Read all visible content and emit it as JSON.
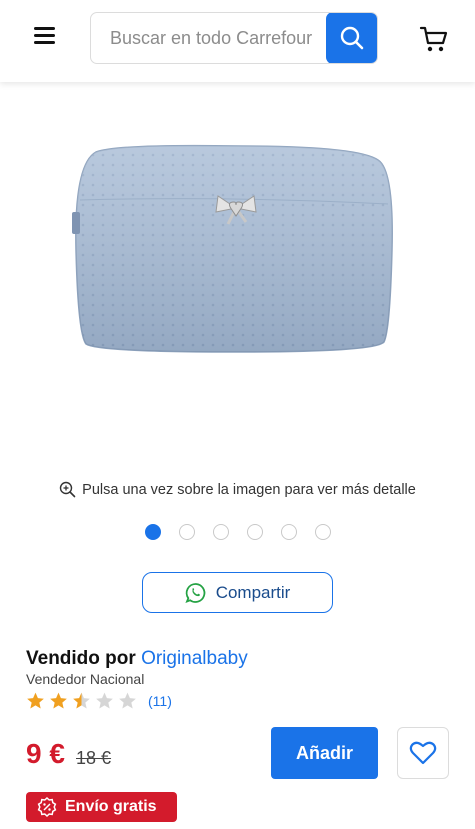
{
  "header": {
    "menu_icon": "hamburger-menu-icon",
    "search": {
      "placeholder": "Buscar en todo Carrefour",
      "value": ""
    },
    "search_icon": "search-icon",
    "cart_icon": "cart-icon"
  },
  "product": {
    "image_alt": "Neceser bebé acolchado azul con lazo",
    "zoom_hint": "Pulsa una vez sobre la imagen para ver más detalle",
    "image_count": 6,
    "active_image": 1
  },
  "share": {
    "label": "Compartir",
    "icon": "whatsapp-icon"
  },
  "seller": {
    "prefix": "Vendido por",
    "name": "Originalbaby",
    "type": "Vendedor Nacional"
  },
  "rating": {
    "value": 2.5,
    "max": 5,
    "count": "(11)"
  },
  "pricing": {
    "price": "9 €",
    "old_price": "18 €"
  },
  "actions": {
    "add_label": "Añadir",
    "favorite_icon": "heart-icon"
  },
  "shipping": {
    "label": "Envío gratis",
    "icon": "discount-badge-icon"
  },
  "colors": {
    "accent": "#1a73e8",
    "price_red": "#d31b2c",
    "star": "#f0a020",
    "star_empty": "#d6d6d6"
  }
}
